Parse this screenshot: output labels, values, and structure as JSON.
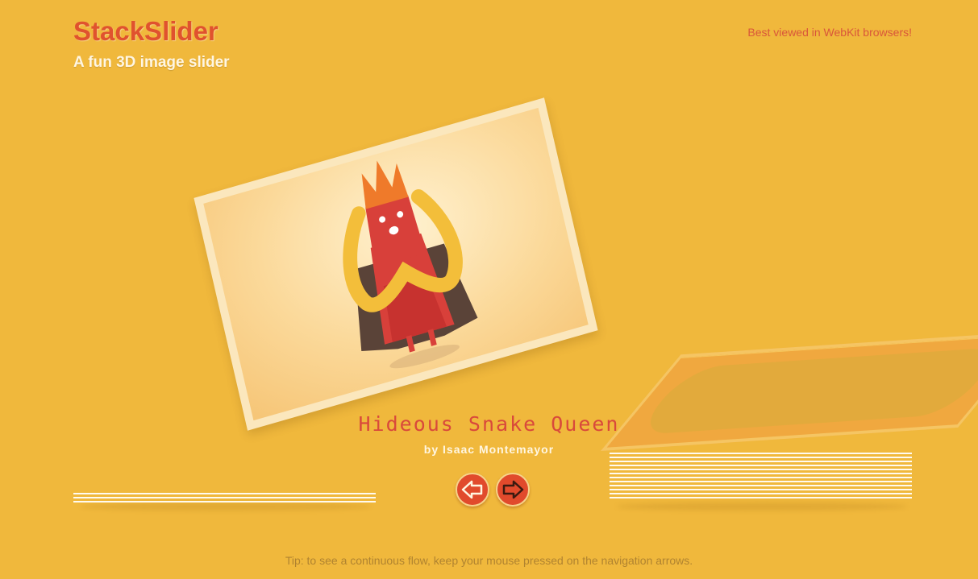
{
  "header": {
    "title": "StackSlider",
    "subtitle": "A fun 3D image slider",
    "note": "Best viewed in WebKit browsers!"
  },
  "slide": {
    "title": "Hideous Snake Queen",
    "author": "by Isaac Montemayor"
  },
  "nav": {
    "prev_icon": "arrow-left-icon",
    "next_icon": "arrow-right-icon"
  },
  "footer": {
    "tip": "Tip: to see a continuous flow, keep your mouse pressed on the navigation arrows."
  },
  "colors": {
    "background": "#f0b83c",
    "accent": "#e0522e",
    "button": "#e14a2c"
  }
}
